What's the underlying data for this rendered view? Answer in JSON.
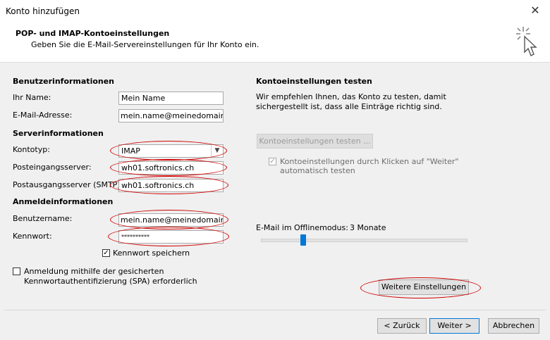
{
  "window": {
    "title": "Konto hinzufügen",
    "close_glyph": "✕"
  },
  "header": {
    "title": "POP- und IMAP-Kontoeinstellungen",
    "subtitle": "Geben Sie die E-Mail-Servereinstellungen für Ihr Konto ein.",
    "icon": "wizard-sparkle-cursor-icon"
  },
  "user_info": {
    "heading": "Benutzerinformationen",
    "name_label": "Ihr Name:",
    "name_value": "Mein Name",
    "email_label": "E-Mail-Adresse:",
    "email_value": "mein.name@meinedomain.ch"
  },
  "server_info": {
    "heading": "Serverinformationen",
    "account_type_label": "Kontotyp:",
    "account_type_value": "IMAP",
    "incoming_label": "Posteingangsserver:",
    "incoming_value": "wh01.softronics.ch",
    "outgoing_label": "Postausgangsserver (SMTP):",
    "outgoing_value": "wh01.softronics.ch"
  },
  "login_info": {
    "heading": "Anmeldeinformationen",
    "username_label": "Benutzername:",
    "username_value": "mein.name@meinedomain.ch",
    "password_label": "Kennwort:",
    "password_value": "**********",
    "remember_password_label": "Kennwort speichern",
    "remember_password_checked": true,
    "spa_label_line1": "Anmeldung mithilfe der gesicherten",
    "spa_label_line2": "Kennwortauthentifizierung (SPA) erforderlich",
    "spa_checked": false
  },
  "test_settings": {
    "heading": "Kontoeinstellungen testen",
    "description_line1": "Wir empfehlen Ihnen, das Konto zu testen, damit",
    "description_line2": "sichergestellt ist, dass alle Einträge richtig sind.",
    "test_button_label": "Kontoeinstellungen testen ...",
    "auto_test_label_line1": "Kontoeinstellungen durch Klicken auf \"Weiter\"",
    "auto_test_label_line2": "automatisch testen",
    "auto_test_checked": true
  },
  "offline": {
    "label": "E-Mail im Offlinemodus:",
    "value": "3 Monate",
    "slider_fraction": 0.2
  },
  "buttons": {
    "more_settings": "Weitere Einstellungen",
    "back": "< Zurück",
    "next": "Weiter >",
    "cancel": "Abbrechen"
  },
  "highlight_color": "#d00000",
  "accent_color": "#0078d7"
}
